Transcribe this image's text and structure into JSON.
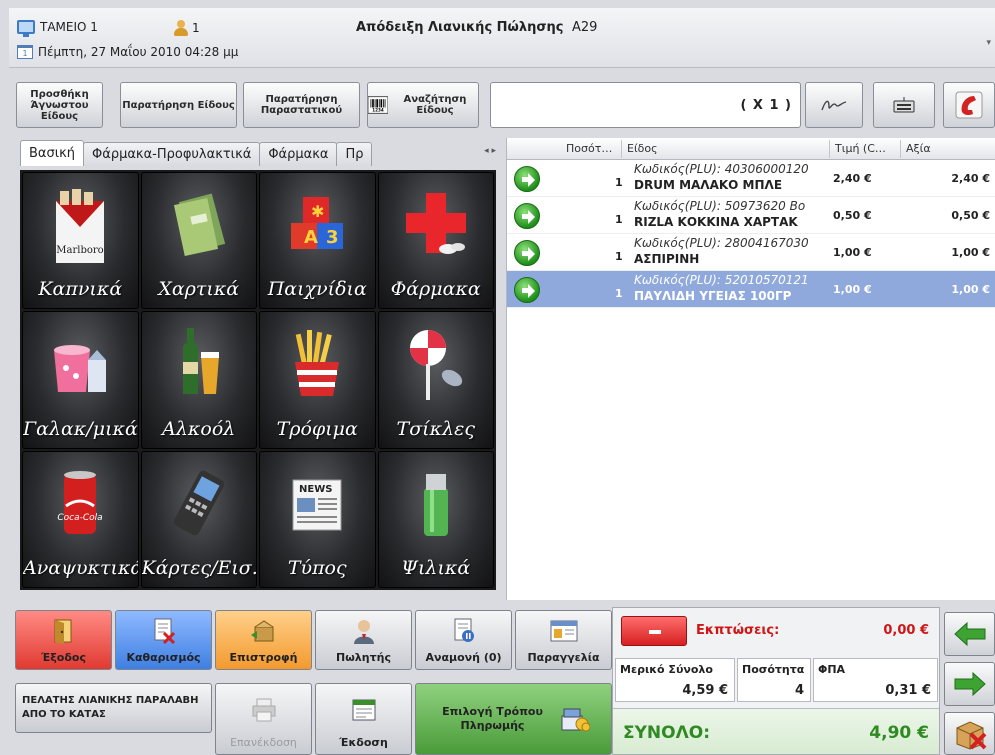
{
  "titlebar": {
    "register": "ΤΑΜΕΙΟ 1",
    "user_count": "1",
    "title": "Απόδειξη Λιανικής Πώλησης",
    "doc_number": "Α29",
    "datetime": "Πέμπτη, 27 Μαΐου 2010 04:28 μμ"
  },
  "toolbar": {
    "add_unknown": "Προσθήκη Άγνωστου Είδους",
    "item_note": "Παρατήρηση Είδους",
    "doc_note": "Παρατήρηση Παραστατικού",
    "search": "Αναζήτηση Είδους",
    "multiplier": "( X 1 )"
  },
  "tabs": [
    "Βασική",
    "Φάρμακα-Προφυλακτικά",
    "Φάρμακα",
    "Πρ"
  ],
  "categories": [
    "Καπνικά",
    "Χαρτικά",
    "Παιχνίδια",
    "Φάρμακα",
    "Γαλακ/μικά",
    "Αλκοόλ",
    "Τρόφιμα",
    "Τσίκλες",
    "Αναψυκτικά",
    "Κάρτες/Εισ.",
    "Τύπος",
    "Ψιλικά"
  ],
  "list": {
    "headers": {
      "qty": "Ποσότ…",
      "item": "Είδος",
      "price": "Τιμή (C…",
      "value": "Αξία"
    },
    "rows": [
      {
        "qty": "1",
        "plu": "Κωδικός(PLU): 40306000120",
        "name": "DRUM ΜΑΛΑΚΟ ΜΠΛΕ",
        "price": "2,40 €",
        "value": "2,40 €"
      },
      {
        "qty": "1",
        "plu": "Κωδικός(PLU): 50973620 Βο",
        "name": "RIZLA ΚΟΚΚΙΝΑ ΧΑΡΤΑΚ",
        "price": "0,50 €",
        "value": "0,50 €"
      },
      {
        "qty": "1",
        "plu": "Κωδικός(PLU): 28004167030",
        "name": "ΑΣΠΙΡΙΝΗ",
        "price": "1,00 €",
        "value": "1,00 €"
      },
      {
        "qty": "1",
        "plu": "Κωδικός(PLU): 52010570121",
        "name": "ΠΑΥΛΙΔΗ ΥΓΕΙΑΣ 100ΓΡ",
        "price": "1,00 €",
        "value": "1,00 €"
      }
    ]
  },
  "buttons": {
    "exit": "Έξοδος",
    "clear": "Καθαρισμός",
    "return": "Επιστροφή",
    "seller": "Πωλητής",
    "hold": "Αναμονή (0)",
    "order": "Παραγγελία",
    "customer": "ΠΕΛΑΤΗΣ ΛΙΑΝΙΚΗΣ ΠΑΡΑΛΑΒΗ ΑΠΟ ΤΟ ΚΑΤΑΣ",
    "reissue": "Επανέκδοση",
    "issue": "Έκδοση",
    "payment": "Επιλογή Τρόπου Πληρωμής"
  },
  "totals": {
    "discount_label": "Εκπτώσεις:",
    "discount_value": "0,00 €",
    "subtotal_label": "Μερικό Σύνολο",
    "subtotal_value": "4,59 €",
    "quantity_label": "Ποσότητα",
    "quantity_value": "4",
    "vat_label": "ΦΠΑ",
    "vat_value": "0,31 €",
    "total_label": "ΣΥΝΟΛΟ:",
    "total_value": "4,90 €"
  },
  "colors": {
    "selected_row": "#8fa9dc",
    "total_green": "#2f8a22",
    "discount_red": "#d01515"
  }
}
